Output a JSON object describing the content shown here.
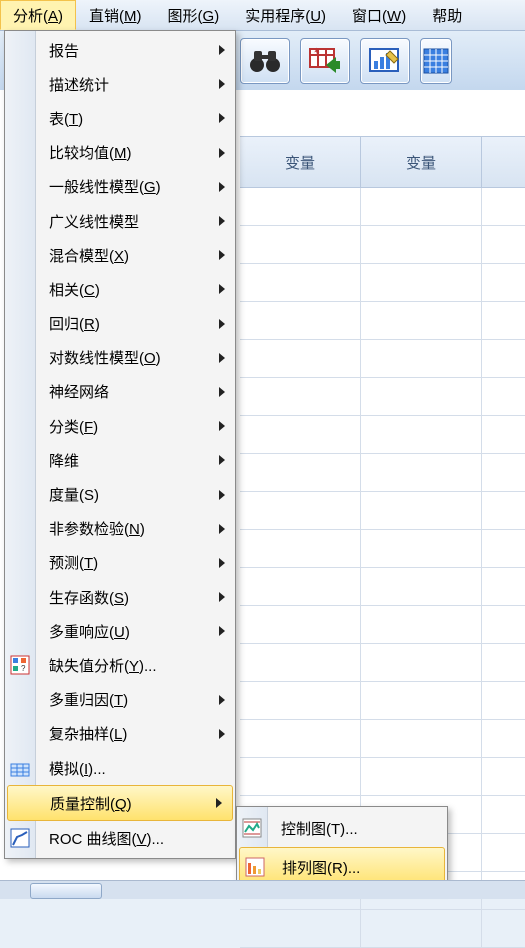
{
  "menubar": {
    "analyze": {
      "pre": "分析(",
      "ax": "A",
      "post": ")"
    },
    "direct": {
      "pre": "直销(",
      "ax": "M",
      "post": ")"
    },
    "graphs": {
      "pre": "图形(",
      "ax": "G",
      "post": ")"
    },
    "utilities": {
      "pre": "实用程序(",
      "ax": "U",
      "post": ")"
    },
    "window": {
      "pre": "窗口(",
      "ax": "W",
      "post": ")"
    },
    "help": {
      "label": "帮助"
    }
  },
  "column_header": "变量",
  "analyze_menu": [
    {
      "key": "reports",
      "pre": "报告",
      "ax": "",
      "post": "",
      "sub": true
    },
    {
      "key": "descriptives",
      "pre": "描述统计",
      "ax": "",
      "post": "",
      "sub": true
    },
    {
      "key": "tables",
      "pre": "表(",
      "ax": "T",
      "post": ")",
      "sub": true
    },
    {
      "key": "compare",
      "pre": "比较均值(",
      "ax": "M",
      "post": ")",
      "sub": true
    },
    {
      "key": "glm",
      "pre": "一般线性模型(",
      "ax": "G",
      "post": ")",
      "sub": true
    },
    {
      "key": "gzlm",
      "pre": "广义线性模型",
      "ax": "",
      "post": "",
      "sub": true
    },
    {
      "key": "mixed",
      "pre": "混合模型(",
      "ax": "X",
      "post": ")",
      "sub": true
    },
    {
      "key": "corr",
      "pre": "相关(",
      "ax": "C",
      "post": ")",
      "sub": true
    },
    {
      "key": "reg",
      "pre": "回归(",
      "ax": "R",
      "post": ")",
      "sub": true
    },
    {
      "key": "loglin",
      "pre": "对数线性模型(",
      "ax": "O",
      "post": ")",
      "sub": true
    },
    {
      "key": "nn",
      "pre": "神经网络",
      "ax": "",
      "post": "",
      "sub": true
    },
    {
      "key": "classify",
      "pre": "分类(",
      "ax": "F",
      "post": ")",
      "sub": true
    },
    {
      "key": "dimred",
      "pre": "降维",
      "ax": "",
      "post": "",
      "sub": true
    },
    {
      "key": "scale",
      "pre": "度量(S)",
      "ax": "",
      "post": "",
      "sub": true
    },
    {
      "key": "nonpar",
      "pre": "非参数检验(",
      "ax": "N",
      "post": ")",
      "sub": true
    },
    {
      "key": "forecast",
      "pre": "预测(",
      "ax": "T",
      "post": ")",
      "sub": true
    },
    {
      "key": "survival",
      "pre": "生存函数(",
      "ax": "S",
      "post": ")",
      "sub": true
    },
    {
      "key": "multresp",
      "pre": "多重响应(",
      "ax": "U",
      "post": ")",
      "sub": true
    },
    {
      "key": "mva",
      "pre": "缺失值分析(",
      "ax": "Y",
      "post": ")...",
      "sub": false,
      "icon": "mva"
    },
    {
      "key": "mi",
      "pre": "多重归因(",
      "ax": "T",
      "post": ")",
      "sub": true
    },
    {
      "key": "complex",
      "pre": "复杂抽样(",
      "ax": "L",
      "post": ")",
      "sub": true
    },
    {
      "key": "sim",
      "pre": "模拟(",
      "ax": "I",
      "post": ")...",
      "sub": false,
      "icon": "sim"
    },
    {
      "key": "qc",
      "pre": "质量控制(",
      "ax": "Q",
      "post": ")",
      "sub": true,
      "highlight": true
    },
    {
      "key": "roc",
      "pre": "ROC 曲线图(",
      "ax": "V",
      "post": ")...",
      "sub": false,
      "icon": "roc"
    }
  ],
  "qc_submenu": [
    {
      "key": "control",
      "pre": "控制图(",
      "ax": "T",
      "post": ")...",
      "icon": "ctrl"
    },
    {
      "key": "pareto",
      "pre": "排列图(",
      "ax": "R",
      "post": ")...",
      "icon": "pareto",
      "highlight": true
    }
  ]
}
